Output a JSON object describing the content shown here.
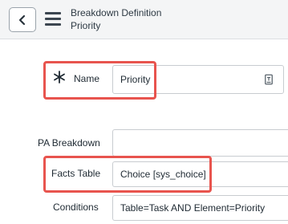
{
  "header": {
    "back_label": "Back",
    "title": "Breakdown Definition",
    "subtitle": "Priority"
  },
  "form": {
    "name": {
      "label": "Name",
      "value": "Priority",
      "required": true
    },
    "pa_breakdown": {
      "label": "PA Breakdown",
      "value": ""
    },
    "facts_table": {
      "label": "Facts Table",
      "value": "Choice [sys_choice]"
    },
    "conditions": {
      "label": "Conditions",
      "value": "Table=Task AND Element=Priority"
    }
  },
  "colors": {
    "highlight": "#e8544e",
    "header_bg": "#f4f5f6",
    "field_border": "#c8ccd0"
  },
  "icons": [
    "chevron-left-icon",
    "hamburger-menu-icon",
    "required-asterisk-icon",
    "field-info-icon"
  ]
}
